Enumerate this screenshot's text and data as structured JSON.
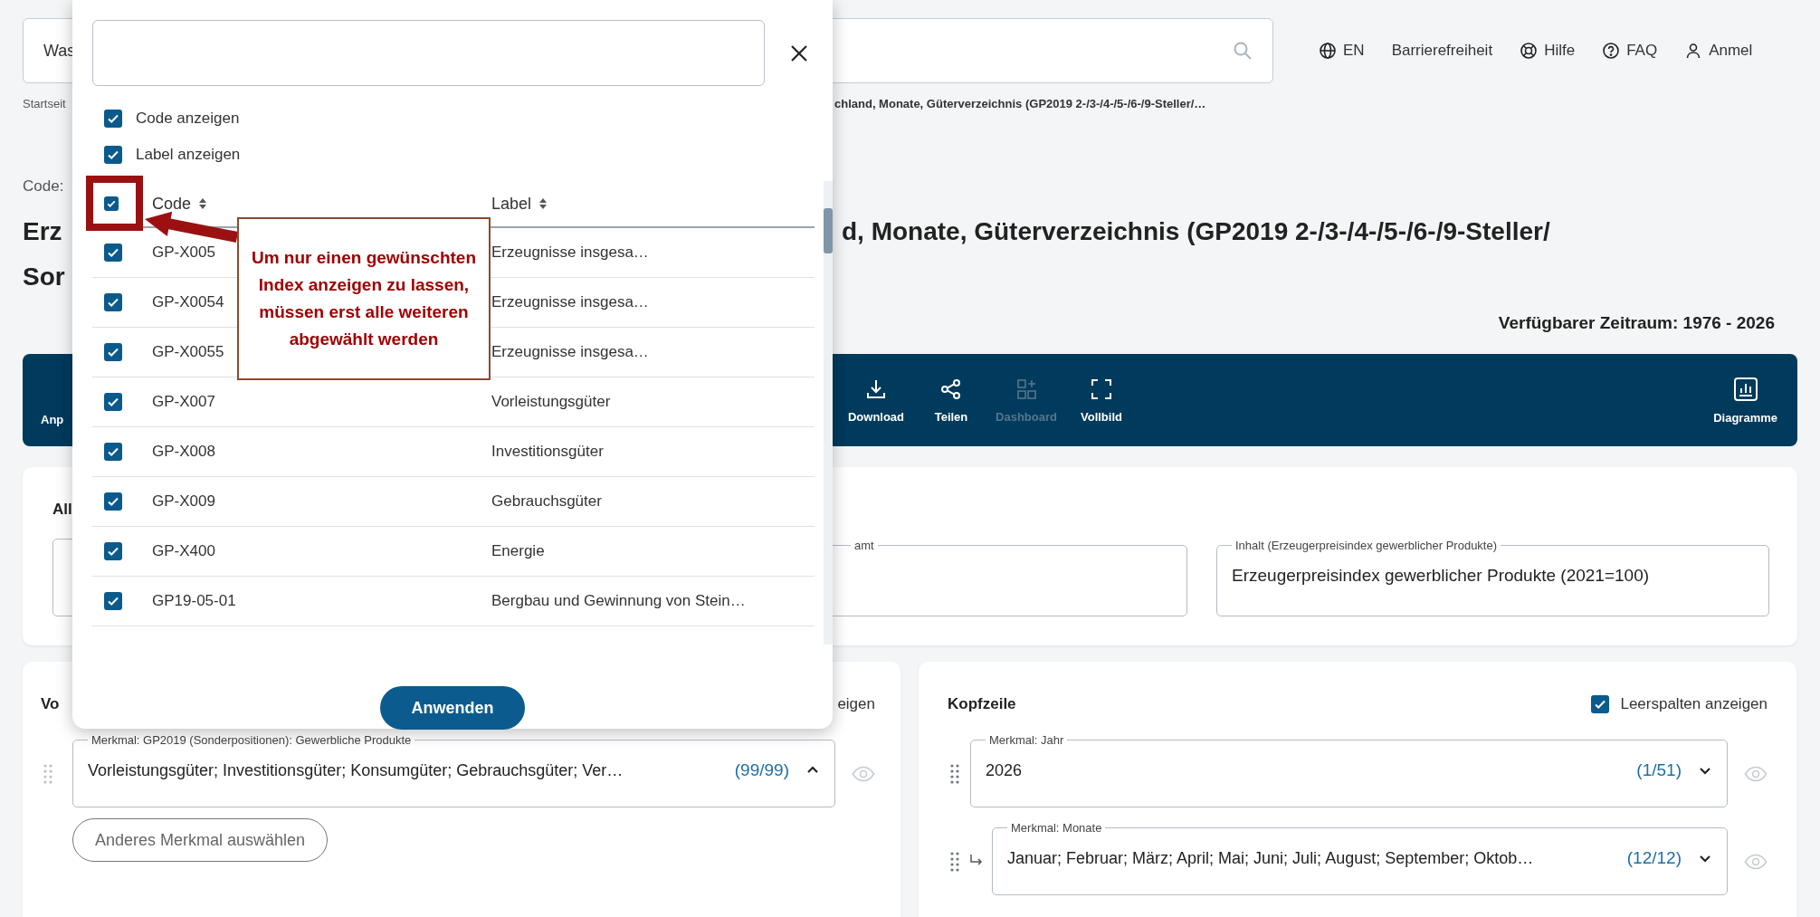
{
  "search": {
    "placeholder": "Was"
  },
  "nav": [
    {
      "kind": "globe",
      "label": "EN"
    },
    {
      "kind": "text",
      "label": "Barrierefreiheit"
    },
    {
      "kind": "lifebuoy",
      "label": "Hilfe"
    },
    {
      "kind": "question",
      "label": "FAQ"
    },
    {
      "kind": "user",
      "label": "Anmel"
    }
  ],
  "breadcrumb": {
    "first": "Startseit",
    "current": "chland, Monate, Güterverzeichnis (GP2019 2-/3-/4-/5-/6-/9-Steller/…"
  },
  "code_label": "Code:",
  "title": {
    "line1_left": "Erz",
    "line1_right": "d, Monate, Güterverzeichnis (GP2019 2-/3-/4-/5-/6-/9-Steller/",
    "line2_left": "Sor"
  },
  "period": "Verfügbarer Zeitraum: 1976 - 2026",
  "toolbar": {
    "cut_label": "Anp",
    "items": [
      {
        "kind": "download",
        "label": "Download",
        "disabled": false
      },
      {
        "kind": "share",
        "label": "Teilen",
        "disabled": false
      },
      {
        "kind": "dashboard",
        "label": "Dashboard",
        "disabled": true
      },
      {
        "kind": "fullscreen",
        "label": "Vollbild",
        "disabled": false
      },
      {
        "kind": "chart",
        "label": "Diagramme",
        "disabled": false
      }
    ]
  },
  "filters": {
    "title": "All",
    "fields": [
      {
        "legend": "amt"
      },
      {
        "legend": "Inhalt (Erzeugerpreisindex gewerblicher Produkte)",
        "value": "Erzeugerpreisindex gewerblicher Produkte (2021=100)"
      }
    ]
  },
  "rows_card": {
    "title": "Vo",
    "option": "eigen",
    "field": {
      "legend": "Merkmal: GP2019 (Sonderpositionen): Gewerbliche Produkte",
      "value": "Vorleistungsgüter; Investitionsgüter; Konsumgüter; Gebrauchsgüter; Ver…",
      "count": "(99/99)",
      "expanded": true
    },
    "button": "Anderes Merkmal auswählen"
  },
  "header_card": {
    "title": "Kopfzeile",
    "option": {
      "label": "Leerspalten anzeigen",
      "checked": true
    },
    "fields": [
      {
        "kind": "main",
        "legend": "Merkmal: Jahr",
        "value": "2026",
        "count": "(1/51)",
        "expanded": false
      },
      {
        "kind": "sub",
        "legend": "Merkmal: Monate",
        "value": "Januar; Februar; März; April; Mai; Juni; Juli; August; September; Oktob…",
        "count": "(12/12)",
        "expanded": false
      }
    ]
  },
  "dialog": {
    "options": [
      {
        "label": "Code anzeigen",
        "checked": true
      },
      {
        "label": "Label anzeigen",
        "checked": true
      }
    ],
    "table": {
      "header_checked": true,
      "columns": [
        "Code",
        "Label"
      ],
      "rows": [
        {
          "code": "GP-X005",
          "label": "Erzeugnisse insgesa…",
          "checked": true
        },
        {
          "code": "GP-X0054",
          "label": "Erzeugnisse insgesa…",
          "checked": true
        },
        {
          "code": "GP-X0055",
          "label": "Erzeugnisse insgesa…",
          "checked": true
        },
        {
          "code": "GP-X007",
          "label": "Vorleistungsgüter",
          "checked": true
        },
        {
          "code": "GP-X008",
          "label": "Investitionsgüter",
          "checked": true
        },
        {
          "code": "GP-X009",
          "label": "Gebrauchsgüter",
          "checked": true
        },
        {
          "code": "GP-X400",
          "label": "Energie",
          "checked": true
        },
        {
          "code": "GP19-05-01",
          "label": "Bergbau und Gewinnung von Stein…",
          "checked": true
        }
      ]
    },
    "apply": "Anwenden"
  },
  "annotation": {
    "text": "Um nur einen gewünschten Index anzeigen zu lassen, müssen erst alle weiteren abgewählt werden"
  }
}
